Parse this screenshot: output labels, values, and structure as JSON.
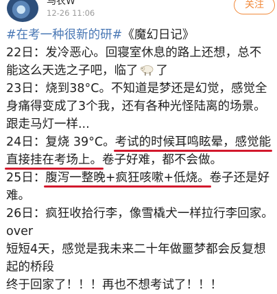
{
  "header": {
    "username": "马农W",
    "timestamp": "12-26 11:06",
    "follow_label": "关注"
  },
  "post": {
    "l1_tag": "#在考一种很新的研#",
    "l1_rest": "《魔幻日记》",
    "l2": "22日：发冷恶心。回寝室休息的路上还想，总不",
    "l3_before": "能这么天选之子吧，临了",
    "l3_emoji": "sheep-emoji",
    "l3_after": "了",
    "l4": "23日：烧到38°C。不知道是梦还是幻觉，感觉全",
    "l5": "身痛得变成了3个我，还有各种光怪陆离的场景。",
    "l6": "跟走马灯一样...",
    "l7_before": "24日：复烧 39°C。",
    "l7_under": "考试的时候耳鸣眩晕，感觉能",
    "l8_under": "直接挂在考场上。",
    "l8_after": "卷子好难，都不会做。",
    "l9_before": "25日：",
    "l9_under": "腹泻一整晚+疯狂咳嗽+低烧。",
    "l9_after": "卷子还是好",
    "l10": "难。",
    "l11": "26日：疯狂收拾行李，像雪橇犬一样拉行李回家。",
    "l12": "over",
    "l13": "短短4天，感觉是我未来二十年做噩梦都会反复想",
    "l14": "起的桥段",
    "l15": "终于回家了！！！再也不想考试了！！！"
  },
  "colors": {
    "tag": "#4a78b5",
    "follow": "#f1893a",
    "underline": "#d2182c"
  }
}
